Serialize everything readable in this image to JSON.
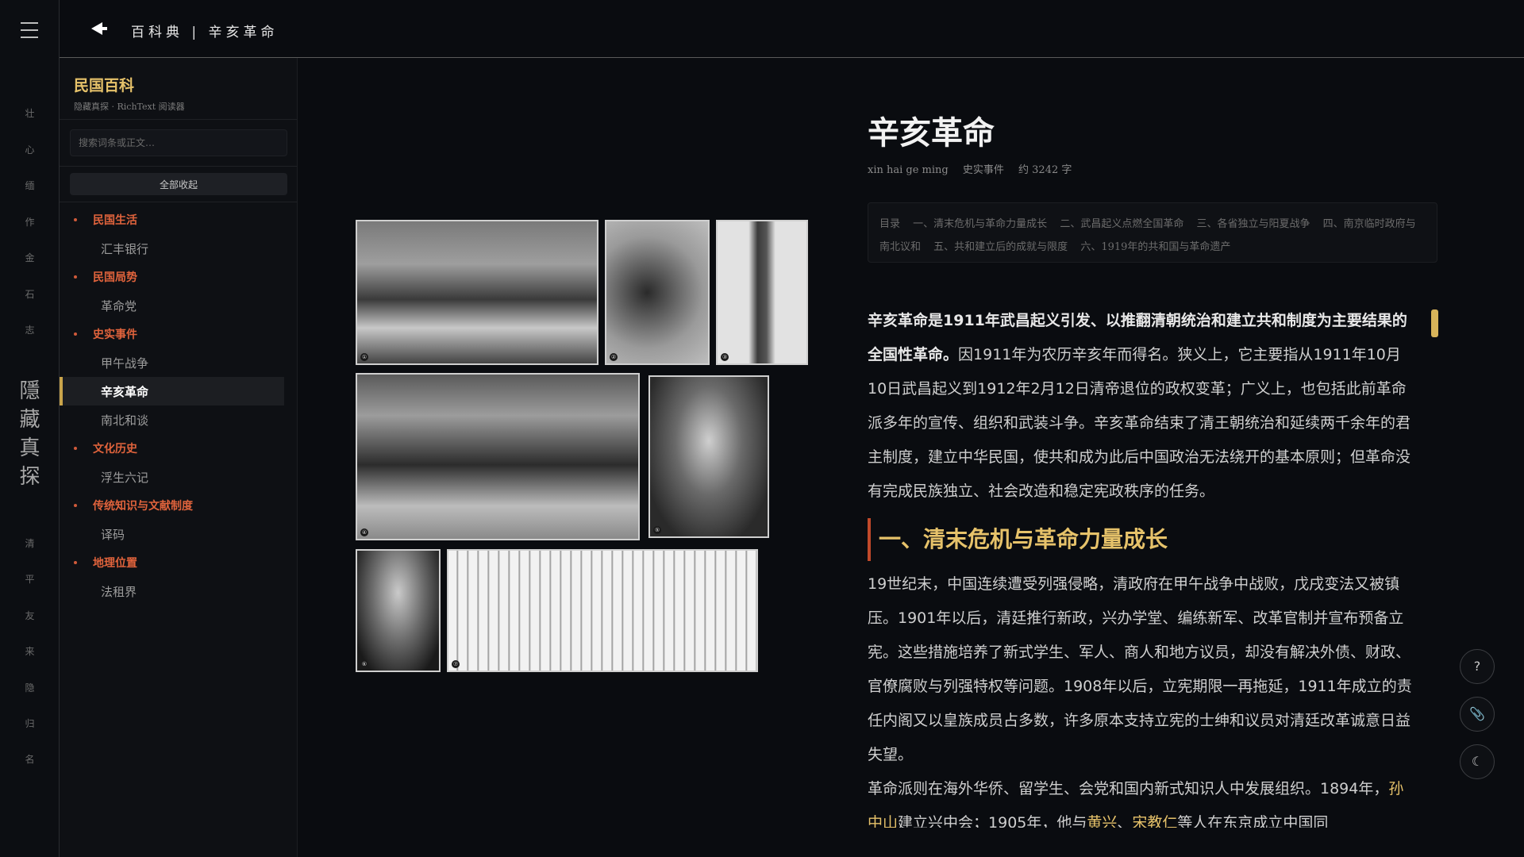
{
  "rail": {
    "top_chars": [
      "壮",
      "心",
      "缅",
      "作",
      "金",
      "石",
      "志"
    ],
    "brand": [
      "隱",
      "藏",
      "真",
      "探"
    ],
    "bottom_chars": [
      "清",
      "平",
      "友",
      "来",
      "隐",
      "归",
      "名"
    ]
  },
  "topbar": {
    "breadcrumb": "百科典 | 辛亥革命"
  },
  "sidebar": {
    "title": "民国百科",
    "subtitle": "隐藏真探 · RichText 阅读器",
    "search_placeholder": "搜索词条或正文…",
    "collapse_label": "全部收起",
    "groups": [
      {
        "label": "民国生活",
        "items": [
          "汇丰银行"
        ]
      },
      {
        "label": "民国局势",
        "items": [
          "革命党"
        ]
      },
      {
        "label": "史实事件",
        "items": [
          "甲午战争",
          "辛亥革命",
          "南北和谈"
        ]
      },
      {
        "label": "文化历史",
        "items": [
          "浮生六记"
        ]
      },
      {
        "label": "传统知识与文献制度",
        "items": [
          "译码"
        ]
      },
      {
        "label": "地理位置",
        "items": [
          "法租界"
        ]
      }
    ],
    "active_item": "辛亥革命"
  },
  "article": {
    "title": "辛亥革命",
    "meta": [
      "xin hai ge ming",
      "史实事件",
      "约 3242 字"
    ],
    "toc_label": "目录",
    "toc": [
      "一、清末危机与革命力量成长",
      "二、武昌起义点燃全国革命",
      "三、各省独立与阳夏战争",
      "四、南京临时政府与南北议和",
      "五、共和建立后的成就与限度",
      "六、1919年的共和国与革命遗产"
    ],
    "lead_bold": "辛亥革命是1911年武昌起义引发、以推翻清朝统治和建立共和制度为主要结果的全国性革命。",
    "lead_rest": "因1911年为农历辛亥年而得名。狭义上，它主要指从1911年10月10日武昌起义到1912年2月12日清帝退位的政权变革；广义上，也包括此前革命派多年的宣传、组织和武装斗争。辛亥革命结束了清王朝统治和延续两千余年的君主制度，建立中华民国，使共和成为此后中国政治无法绕开的基本原则；但革命没有完成民族独立、社会改造和稳定宪政秩序的任务。",
    "section1_title": "一、清末危机与革命力量成长",
    "section1_p1": "19世纪末，中国连续遭受列强侵略，清政府在甲午战争中战败，戊戌变法又被镇压。1901年以后，清廷推行新政，兴办学堂、编练新军、改革官制并宣布预备立宪。这些措施培养了新式学生、军人、商人和地方议员，却没有解决外债、财政、官僚腐败与列强特权等问题。1908年以后，立宪期限一再拖延，1911年成立的责任内阁又以皇族成员占多数，许多原本支持立宪的士绅和议员对清廷改革诚意日益失望。",
    "section1_p2_a": "革命派则在海外华侨、留学生、会党和国内新式知识人中发展组织。1894年，",
    "link1": "孙中山",
    "section1_p2_b": "建立兴中会；1905年，他与",
    "link2": "黄兴",
    "sep": "、",
    "link3": "宋教仁",
    "section1_p2_c": "等人在东京成立中国同"
  },
  "gallery": {
    "photo_numbers": [
      "①",
      "②",
      "③",
      "④",
      "⑤",
      "⑥",
      "⑦"
    ]
  },
  "fabs": {
    "help": "?",
    "clip": "📎",
    "theme": "☾"
  }
}
